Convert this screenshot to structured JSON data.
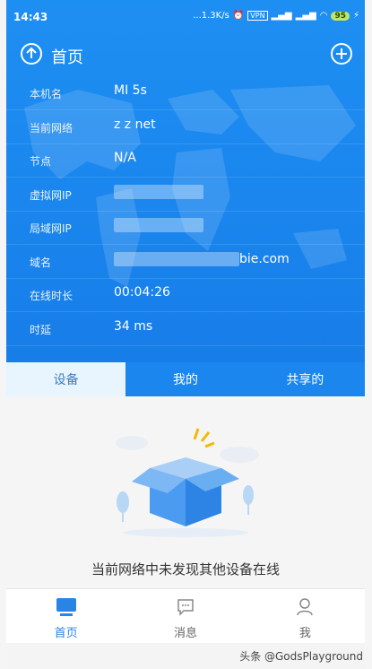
{
  "status_bar": {
    "time": "14:43",
    "speed": "...1.3K/s",
    "vpn": "VPN",
    "battery": "95"
  },
  "header": {
    "title": "首页"
  },
  "info": [
    {
      "label": "本机名",
      "value": "MI 5s",
      "masked": false
    },
    {
      "label": "当前网络",
      "value": "z z net",
      "masked": false
    },
    {
      "label": "节点",
      "value": "N/A",
      "masked": false
    },
    {
      "label": "虚拟网IP",
      "value": "",
      "masked": true
    },
    {
      "label": "局域网IP",
      "value": "",
      "masked": true
    },
    {
      "label": "域名",
      "value": "bie.com",
      "masked": true
    },
    {
      "label": "在线时长",
      "value": "00:04:26",
      "masked": false
    },
    {
      "label": "时延",
      "value": "34 ms",
      "masked": false
    }
  ],
  "tabs": [
    {
      "label": "设备",
      "active": true
    },
    {
      "label": "我的",
      "active": false
    },
    {
      "label": "共享的",
      "active": false
    }
  ],
  "empty_state": {
    "message": "当前网络中未发现其他设备在线"
  },
  "bottom_nav": [
    {
      "label": "首页",
      "active": true,
      "icon": "monitor-icon"
    },
    {
      "label": "消息",
      "active": false,
      "icon": "chat-bubble-icon"
    },
    {
      "label": "我",
      "active": false,
      "icon": "person-icon"
    }
  ],
  "watermark": "头条 @GodsPlayground"
}
